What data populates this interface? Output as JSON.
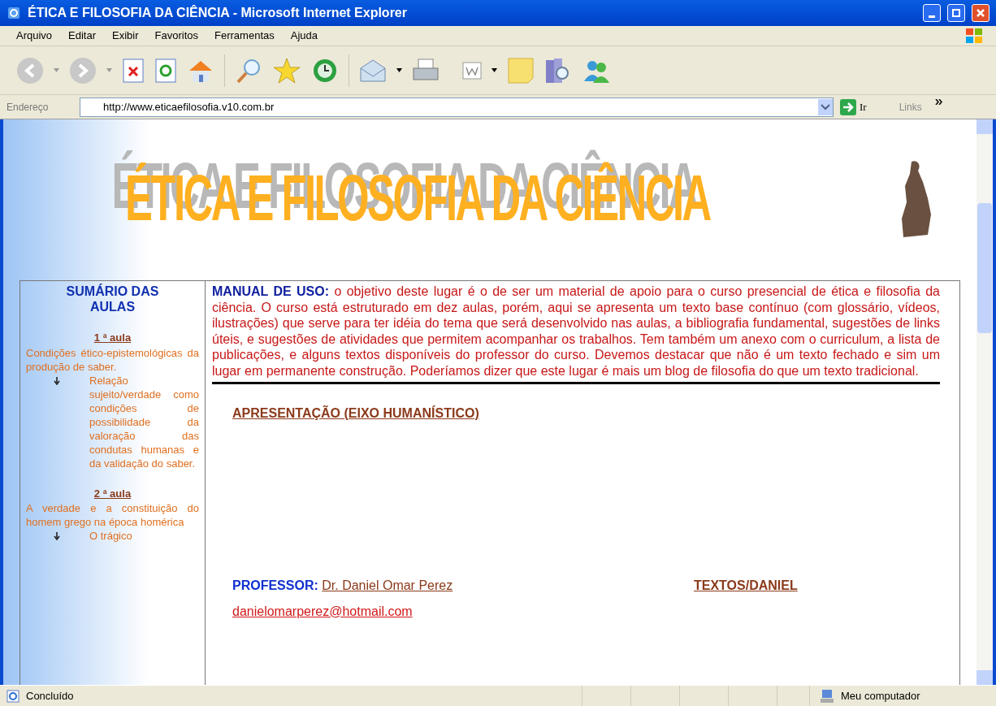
{
  "window": {
    "title": "ÉTICA E FILOSOFIA DA CIÊNCIA - Microsoft Internet Explorer"
  },
  "menu": [
    {
      "label": "Arquivo"
    },
    {
      "label": "Editar"
    },
    {
      "label": "Exibir"
    },
    {
      "label": "Favoritos"
    },
    {
      "label": "Ferramentas"
    },
    {
      "label": "Ajuda"
    }
  ],
  "address_bar": {
    "label": "Endereço",
    "value": "http://www.eticaefilosofia.v10.com.br",
    "go": "Ir",
    "links": "Links"
  },
  "page": {
    "banner_title": "ÉTICA E FILOSOFIA DA CIÊNCIA",
    "sidebar": {
      "title": "SUMÁRIO DAS AULAS",
      "lessons": [
        {
          "heading": "1 ª aula",
          "summary": "Condições ético-epistemológicas da produção de saber.",
          "topics": [
            "Relação sujeito/verdade como condições de possibilidade da valoração das condutas humanas e da validação do saber."
          ]
        },
        {
          "heading": "2 ª aula",
          "summary": "A verdade e a constituição do homem grego na época homérica",
          "topics": [
            "O trágico"
          ]
        }
      ]
    },
    "manual": {
      "label": "MANUAL DE USO:",
      "text": "o objetivo deste lugar é o de ser um material de apoio para o curso presencial de ética e filosofia da ciência. O curso está estruturado em dez aulas, porém, aqui se apresenta um texto base contínuo (com glossário, vídeos, ilustrações) que serve para ter idéia do tema que será desenvolvido nas aulas, a bibliografia fundamental, sugestões de links úteis, e sugestões de atividades que permitem acompanhar os trabalhos. Tem também um anexo com o curriculum, a lista de publicações, e alguns textos disponíveis do professor do curso. Devemos destacar que não é um texto fechado e sim um lugar em permanente construção. Poderíamos dizer que este lugar é mais um blog de filosofia do que um texto tradicional."
    },
    "section_link": "APRESENTAÇÃO (EIXO HUMANÍSTICO)",
    "professor": {
      "label": "PROFESSOR:",
      "name": "Dr. Daniel Omar Perez",
      "email": "danielomarperez@hotmail.com",
      "texts_link": "TEXTOS/DANIEL"
    }
  },
  "status_bar": {
    "status": "Concluído",
    "zone": "Meu computador"
  }
}
